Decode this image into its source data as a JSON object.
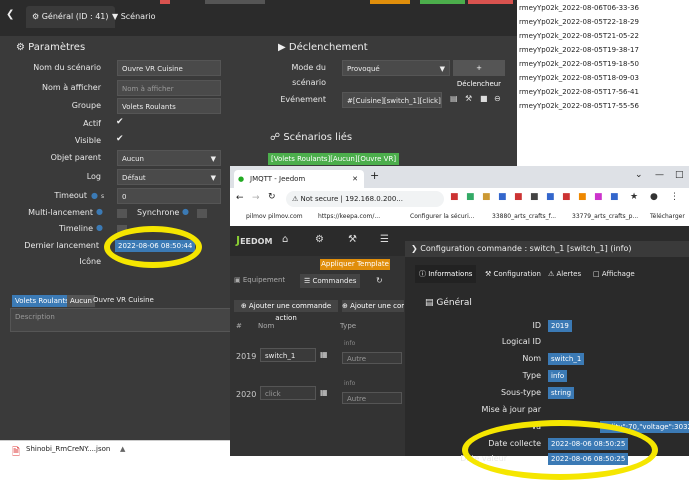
{
  "filelist": [
    "rmeyYp02k_2022-08-06T06-33-36",
    "rmeyYp02k_2022-08-05T22-18-29",
    "rmeyYp02k_2022-08-05T21-05-22",
    "rmeyYp02k_2022-08-05T19-38-17",
    "rmeyYp02k_2022-08-05T19-18-50",
    "rmeyYp02k_2022-08-05T18-09-03",
    "rmeyYp02k_2022-08-05T17-56-41",
    "rmeyYp02k_2022-08-05T17-55-56"
  ],
  "scenario": {
    "tab_general": "Général (ID : 41)",
    "tab_scenario": "Scénario",
    "params_title": "Paramètres",
    "labels": {
      "nom": "Nom du scénario",
      "afficher": "Nom à afficher",
      "groupe": "Groupe",
      "actif": "Actif",
      "visible": "Visible",
      "parent": "Objet parent",
      "log": "Log",
      "timeout": "Timeout",
      "multi": "Multi-lancement",
      "sync": "Synchrone",
      "timeline": "Timeline",
      "dernier": "Dernier lancement",
      "icone": "Icône"
    },
    "values": {
      "nom": "Ouvre VR Cuisine",
      "afficher_ph": "Nom à afficher",
      "groupe": "Volets Roulants",
      "parent": "Aucun",
      "log": "Défaut",
      "timeout": "0",
      "timeout_unit": "s",
      "dernier": "2022-08-06 08:50:44"
    },
    "declench_title": "Déclenchement",
    "mode_label_1": "Mode du",
    "mode_label_2": "scénario",
    "mode_value": "Provoqué",
    "declench_btn": "Déclencheur",
    "evenement_label": "Evénement",
    "evenement_value": "#[Cuisine][switch_1][click]#",
    "lies_title": "Scénarios liés",
    "lies_value": "[Volets Roulants][Aucun][Ouvre VR]",
    "bottom_tags": [
      "Volets Roulants",
      "Aucun"
    ],
    "bottom_name": "Ouvre VR Cuisine",
    "description_ph": "Description"
  },
  "browser": {
    "tab_title": "JMQTT - Jeedom",
    "url_prefix": "Not secure",
    "url": "192.168.0.200...",
    "bookmarks": [
      "pilmov pilmov.com",
      "https://keepa.com/...",
      "Configurer la sécuri...",
      "33880_arts_crafts_f...",
      "33779_arts_crafts_p...",
      "Télécharger"
    ],
    "jeedom_logo": "EEDOM",
    "left_tabs": {
      "apply": "Appliquer Template",
      "equipement": "Equipement",
      "commandes": "Commandes"
    },
    "add_action": "Ajouter une commande action",
    "add_info": "Ajouter une com",
    "cols": {
      "num": "#",
      "nom": "Nom",
      "type": "Type"
    },
    "rows": [
      {
        "id": "2019",
        "name": "switch_1",
        "type": "info"
      },
      {
        "id": "2020",
        "name": "click",
        "type": "info"
      }
    ],
    "type_opts": [
      "Autre",
      "Autre"
    ],
    "config_title": "Configuration commande : switch_1 [switch_1] (info)",
    "config_tabs": [
      "Informations",
      "Configuration",
      "Alertes",
      "Affichage"
    ],
    "section": "Général",
    "fields": [
      {
        "label": "ID",
        "value": "2019"
      },
      {
        "label": "Logical ID",
        "value": ""
      },
      {
        "label": "Nom",
        "value": "switch_1"
      },
      {
        "label": "Type",
        "value": "info"
      },
      {
        "label": "Sous-type",
        "value": "string"
      },
      {
        "label": "Mise à jour par",
        "value": ""
      },
      {
        "label": "Va",
        "value": "uality\":70,\"voltage\":3032}"
      },
      {
        "label": "Date collecte",
        "value": "2022-08-06 08:50:25"
      },
      {
        "label": "Date valeur",
        "value": "2022-08-06 08:50:25"
      }
    ]
  },
  "downloads": {
    "filename": "Shinobi_RmCreNY....json"
  }
}
